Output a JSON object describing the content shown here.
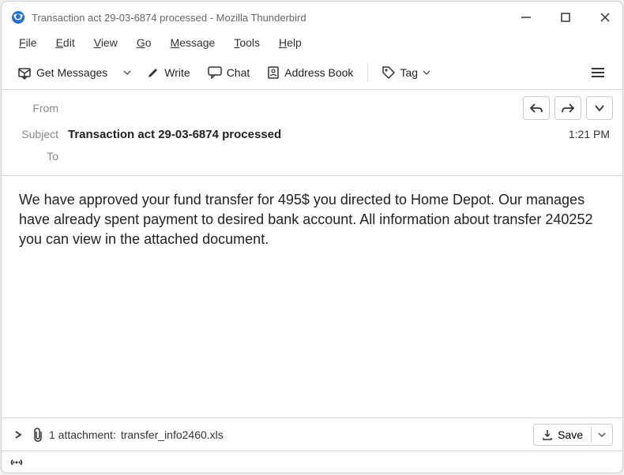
{
  "window": {
    "title": "Transaction act 29-03-6874 processed - Mozilla Thunderbird"
  },
  "menu": {
    "file": "File",
    "edit": "Edit",
    "view": "View",
    "go": "Go",
    "message": "Message",
    "tools": "Tools",
    "help": "Help"
  },
  "toolbar": {
    "get_messages": "Get Messages",
    "write": "Write",
    "chat": "Chat",
    "address_book": "Address Book",
    "tag": "Tag"
  },
  "headers": {
    "from_label": "From",
    "from_value": "",
    "subject_label": "Subject",
    "subject_value": "Transaction act 29-03-6874 processed",
    "to_label": "To",
    "to_value": "",
    "time": "1:21 PM"
  },
  "body": "We have approved your fund transfer for 495$ you directed to Home Depot. Our manages have already spent payment to desired bank account. All information about transfer 240252 you can view in the attached document.",
  "attachment": {
    "count_label": "1 attachment:",
    "filename": "transfer_info2460.xls",
    "save_label": "Save"
  }
}
